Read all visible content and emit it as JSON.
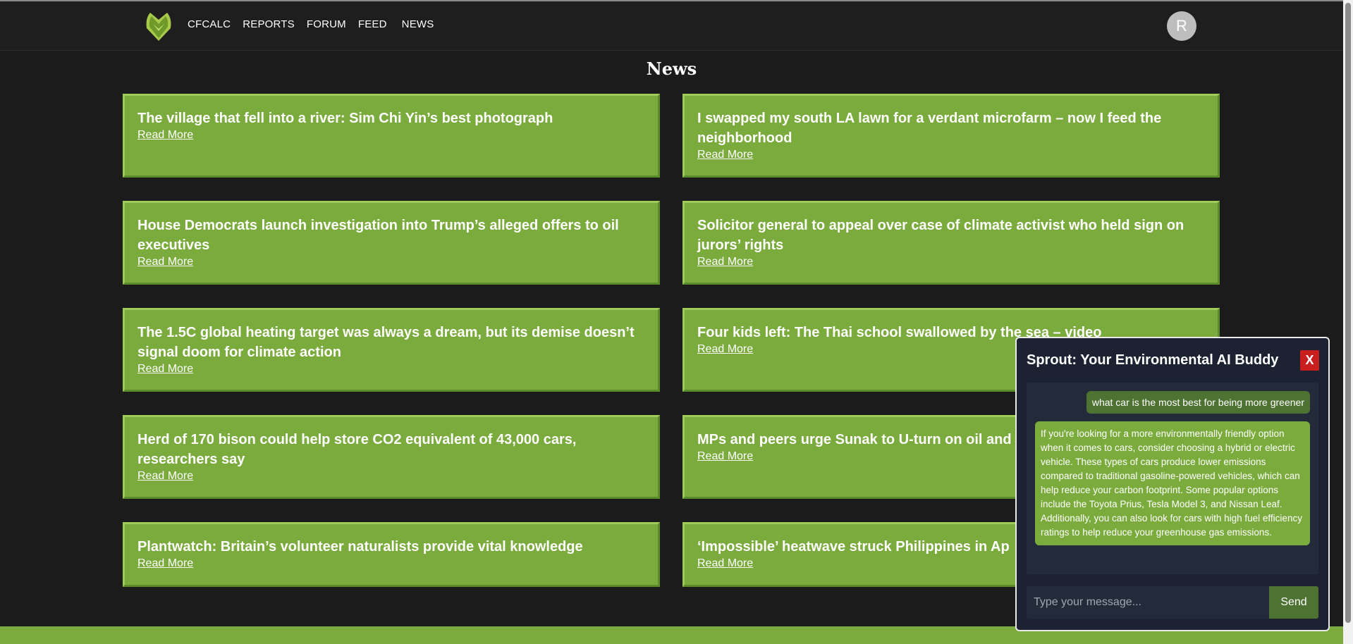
{
  "nav": {
    "logo_icon": "leaf-logo-icon",
    "links": [
      "CFCALC",
      "REPORTS",
      "FORUM",
      "FEED",
      "NEWS"
    ],
    "avatar_initial": "R"
  },
  "page": {
    "title": "News"
  },
  "news": [
    {
      "title": "The village that fell into a river: Sim Chi Yin’s best photograph",
      "link": "Read More"
    },
    {
      "title": "I swapped my south LA lawn for a verdant microfarm – now I feed the neighborhood",
      "link": "Read More"
    },
    {
      "title": "House Democrats launch investigation into Trump’s alleged offers to oil executives",
      "link": "Read More"
    },
    {
      "title": "Solicitor general to appeal over case of climate activist who held sign on jurors’ rights",
      "link": "Read More"
    },
    {
      "title": "The 1.5C global heating target was always a dream, but its demise doesn’t signal doom for climate action",
      "link": "Read More"
    },
    {
      "title": "Four kids left: The Thai school swallowed by the sea – video",
      "link": "Read More"
    },
    {
      "title": "Herd of 170 bison could help store CO2 equivalent of 43,000 cars, researchers say",
      "link": "Read More"
    },
    {
      "title": "MPs and peers urge Sunak to U-turn on oil and",
      "link": "Read More"
    },
    {
      "title": "Plantwatch: Britain’s volunteer naturalists provide vital knowledge",
      "link": "Read More"
    },
    {
      "title": "‘Impossible’ heatwave struck Philippines in Ap",
      "link": "Read More"
    }
  ],
  "chat": {
    "title": "Sprout: Your Environmental AI Buddy",
    "close_label": "X",
    "user_message": "what car is the most best for being more greener",
    "bot_message": "If you're looking for a more environmentally friendly option when it comes to cars, consider choosing a hybrid or electric vehicle. These types of cars produce lower emissions compared to traditional gasoline-powered vehicles, which can help reduce your carbon footprint. Some popular options include the Toyota Prius, Tesla Model 3, and Nissan Leaf. Additionally, you can also look for cars with high fuel efficiency ratings to help reduce your greenhouse gas emissions.",
    "input_placeholder": "Type your message...",
    "send_label": "Send"
  },
  "colors": {
    "background": "#1b1b1b",
    "card_green": "#7aab3c",
    "chat_bg": "#1c2231",
    "close_red": "#c91f1f"
  }
}
